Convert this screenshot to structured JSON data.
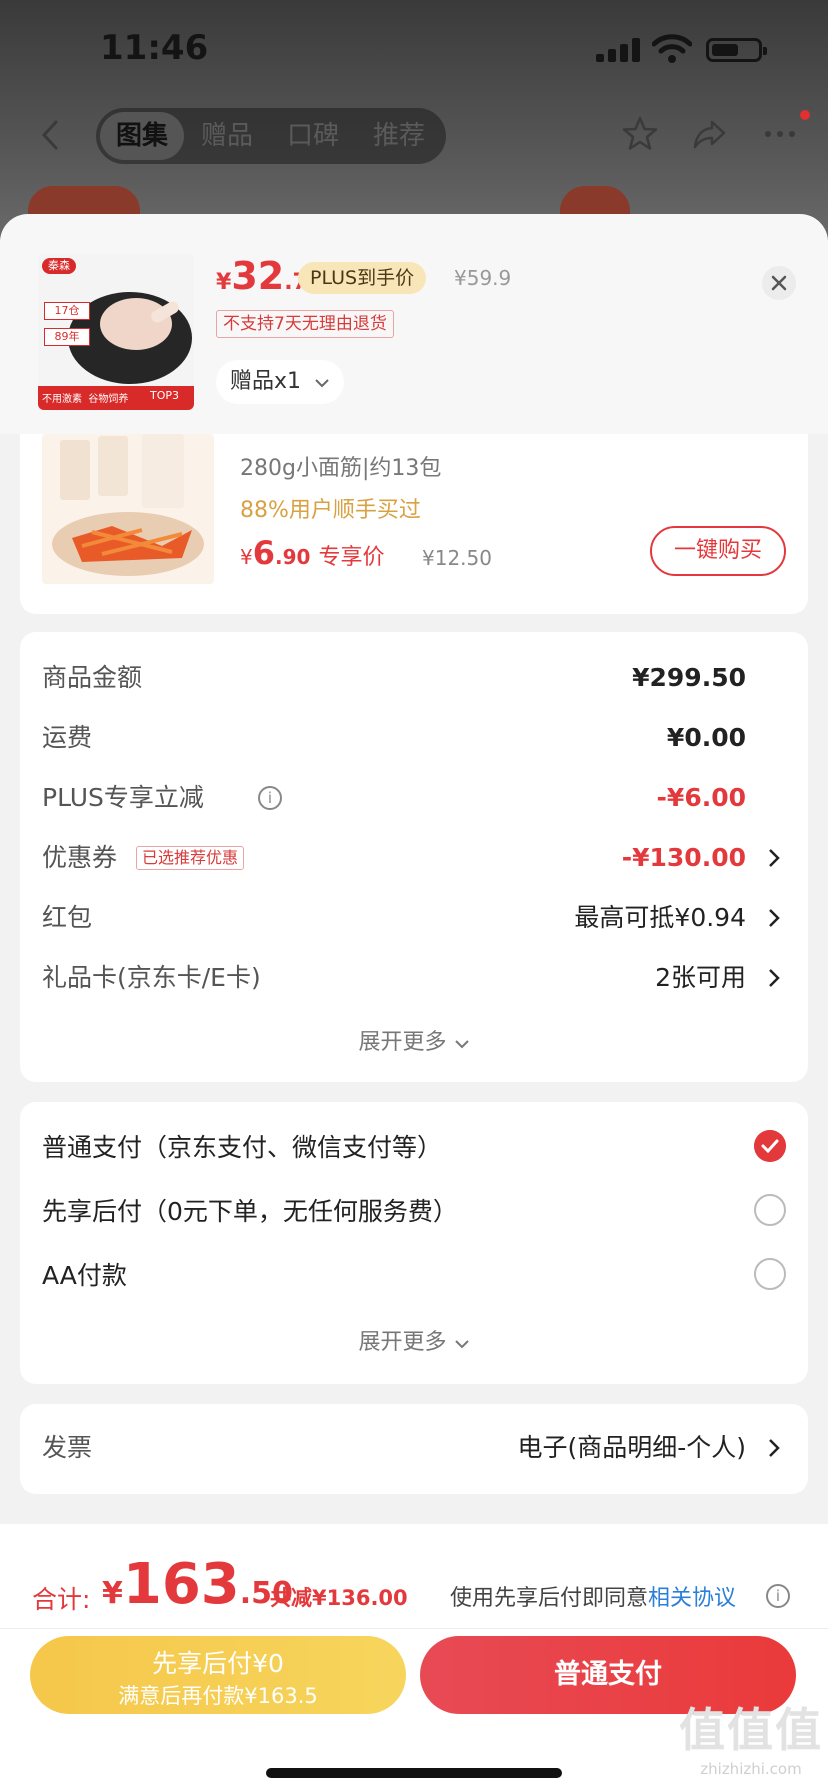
{
  "status_bar": {
    "time": "11:46"
  },
  "nav": {
    "tabs": [
      {
        "label": "图集",
        "active": true
      },
      {
        "label": "赠品",
        "active": false
      },
      {
        "label": "口碑",
        "active": false
      },
      {
        "label": "推荐",
        "active": false
      }
    ]
  },
  "product": {
    "price_currency": "¥",
    "price_int": "32",
    "price_dec": ".7",
    "plus_tag": "PLUS到手价",
    "original_price": "¥59.9",
    "return_warning": "不支持7天无理由退货",
    "gift_select": "赠品x1",
    "thumb_brand": "秦森",
    "thumb_stock": "17仓",
    "thumb_year": "89年",
    "thumb_slogan": "不用激素  谷物饲养",
    "thumb_rank": "TOP3"
  },
  "recommend": {
    "spec": "280g小面筋|约13包",
    "buyers": "88%用户顺手买过",
    "price_currency": "¥",
    "price_int": "6",
    "price_dec": ".90",
    "price_label": "专享价",
    "original_price": "¥12.50",
    "buy_button": "一键购买"
  },
  "summary": {
    "rows": [
      {
        "label": "商品金额",
        "value": "¥299.50"
      },
      {
        "label": "运费",
        "value": "¥0.00"
      },
      {
        "label": "PLUS专享立减",
        "value": "-¥6.00"
      },
      {
        "label": "优惠券",
        "tag": "已选推荐优惠",
        "value": "-¥130.00"
      },
      {
        "label": "红包",
        "value": "最高可抵¥0.94"
      },
      {
        "label": "礼品卡(京东卡/E卡)",
        "value": "2张可用"
      }
    ],
    "expand_label": "展开更多"
  },
  "payment": {
    "options": [
      {
        "label": "普通支付（京东支付、微信支付等）",
        "selected": true
      },
      {
        "label": "先享后付（0元下单，无任何服务费）",
        "selected": false
      },
      {
        "label": "AA付款",
        "selected": false
      }
    ],
    "expand_label": "展开更多"
  },
  "invoice": {
    "label": "发票",
    "value": "电子(商品明细-个人)"
  },
  "footer": {
    "total_label": "合计:",
    "total_currency": "¥",
    "total_int": "163",
    "total_dec": ".50",
    "total_saved": "共减¥136.00",
    "agree_text": "使用先享后付即同意",
    "agree_link": "相关协议",
    "btn_later_line1": "先享后付¥0",
    "btn_later_line2": "满意后再付款¥163.5",
    "btn_normal": "普通支付"
  },
  "watermark": {
    "big": "值值值",
    "small": "zhizhizhi.com"
  },
  "colors": {
    "accent": "#e4393c",
    "gold": "#d8a143",
    "link": "#2a7fd8"
  }
}
